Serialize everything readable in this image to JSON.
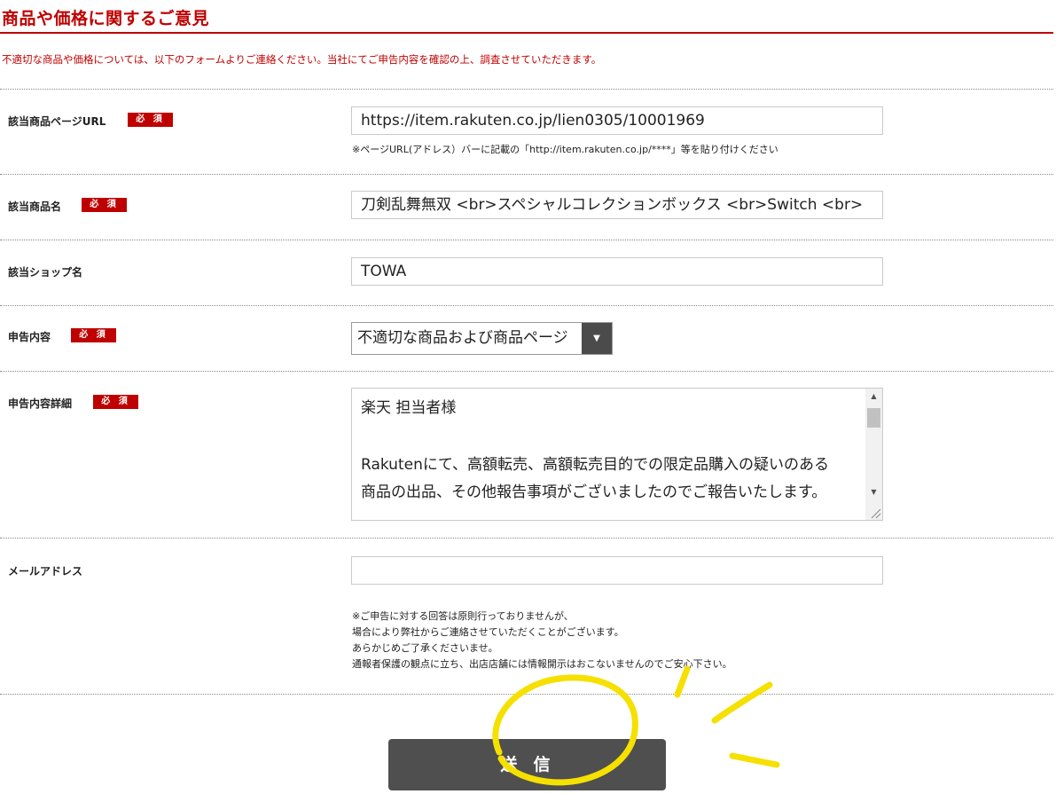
{
  "page": {
    "title": "商品や価格に関するご意見",
    "intro": "不適切な商品や価格については、以下のフォームよりご連絡ください。当社にてご申告内容を確認の上、調査させていただきます。",
    "required_label": "必 須"
  },
  "form": {
    "url": {
      "label": "該当商品ページURL",
      "value": "https://item.rakuten.co.jp/lien0305/10001969",
      "note": "※ページURL(アドレス）バーに記載の「http://item.rakuten.co.jp/****」等を貼り付けください"
    },
    "product_name": {
      "label": "該当商品名",
      "value": "刀剣乱舞無双 <br>スペシャルコレクションボックス <br>Switch <br>"
    },
    "shop_name": {
      "label": "該当ショップ名",
      "value": "TOWA"
    },
    "report_type": {
      "label": "申告内容",
      "selected": "不適切な商品および商品ページ"
    },
    "report_detail": {
      "label": "申告内容詳細",
      "lines": [
        "楽天 担当者様",
        "",
        "Rakutenにて、高額転売、高額転売目的での限定品購入の疑いのある",
        "商品の出品、その他報告事項がございましたのでご報告いたします。"
      ]
    },
    "email": {
      "label": "メールアドレス",
      "value": "",
      "notes": [
        "※ご申告に対する回答は原則行っておりませんが、",
        "場合により弊社からご連絡させていただくことがございます。",
        "あらかじめご了承くださいませ。",
        "通報者保護の観点に立ち、出店店舗には情報開示はおこないませんのでご安心下さい。"
      ]
    },
    "submit_label": "送信"
  },
  "colors": {
    "brand_red": "#bf0000",
    "button_gray": "#4f4f4f",
    "highlight_yellow": "#f5e000"
  }
}
